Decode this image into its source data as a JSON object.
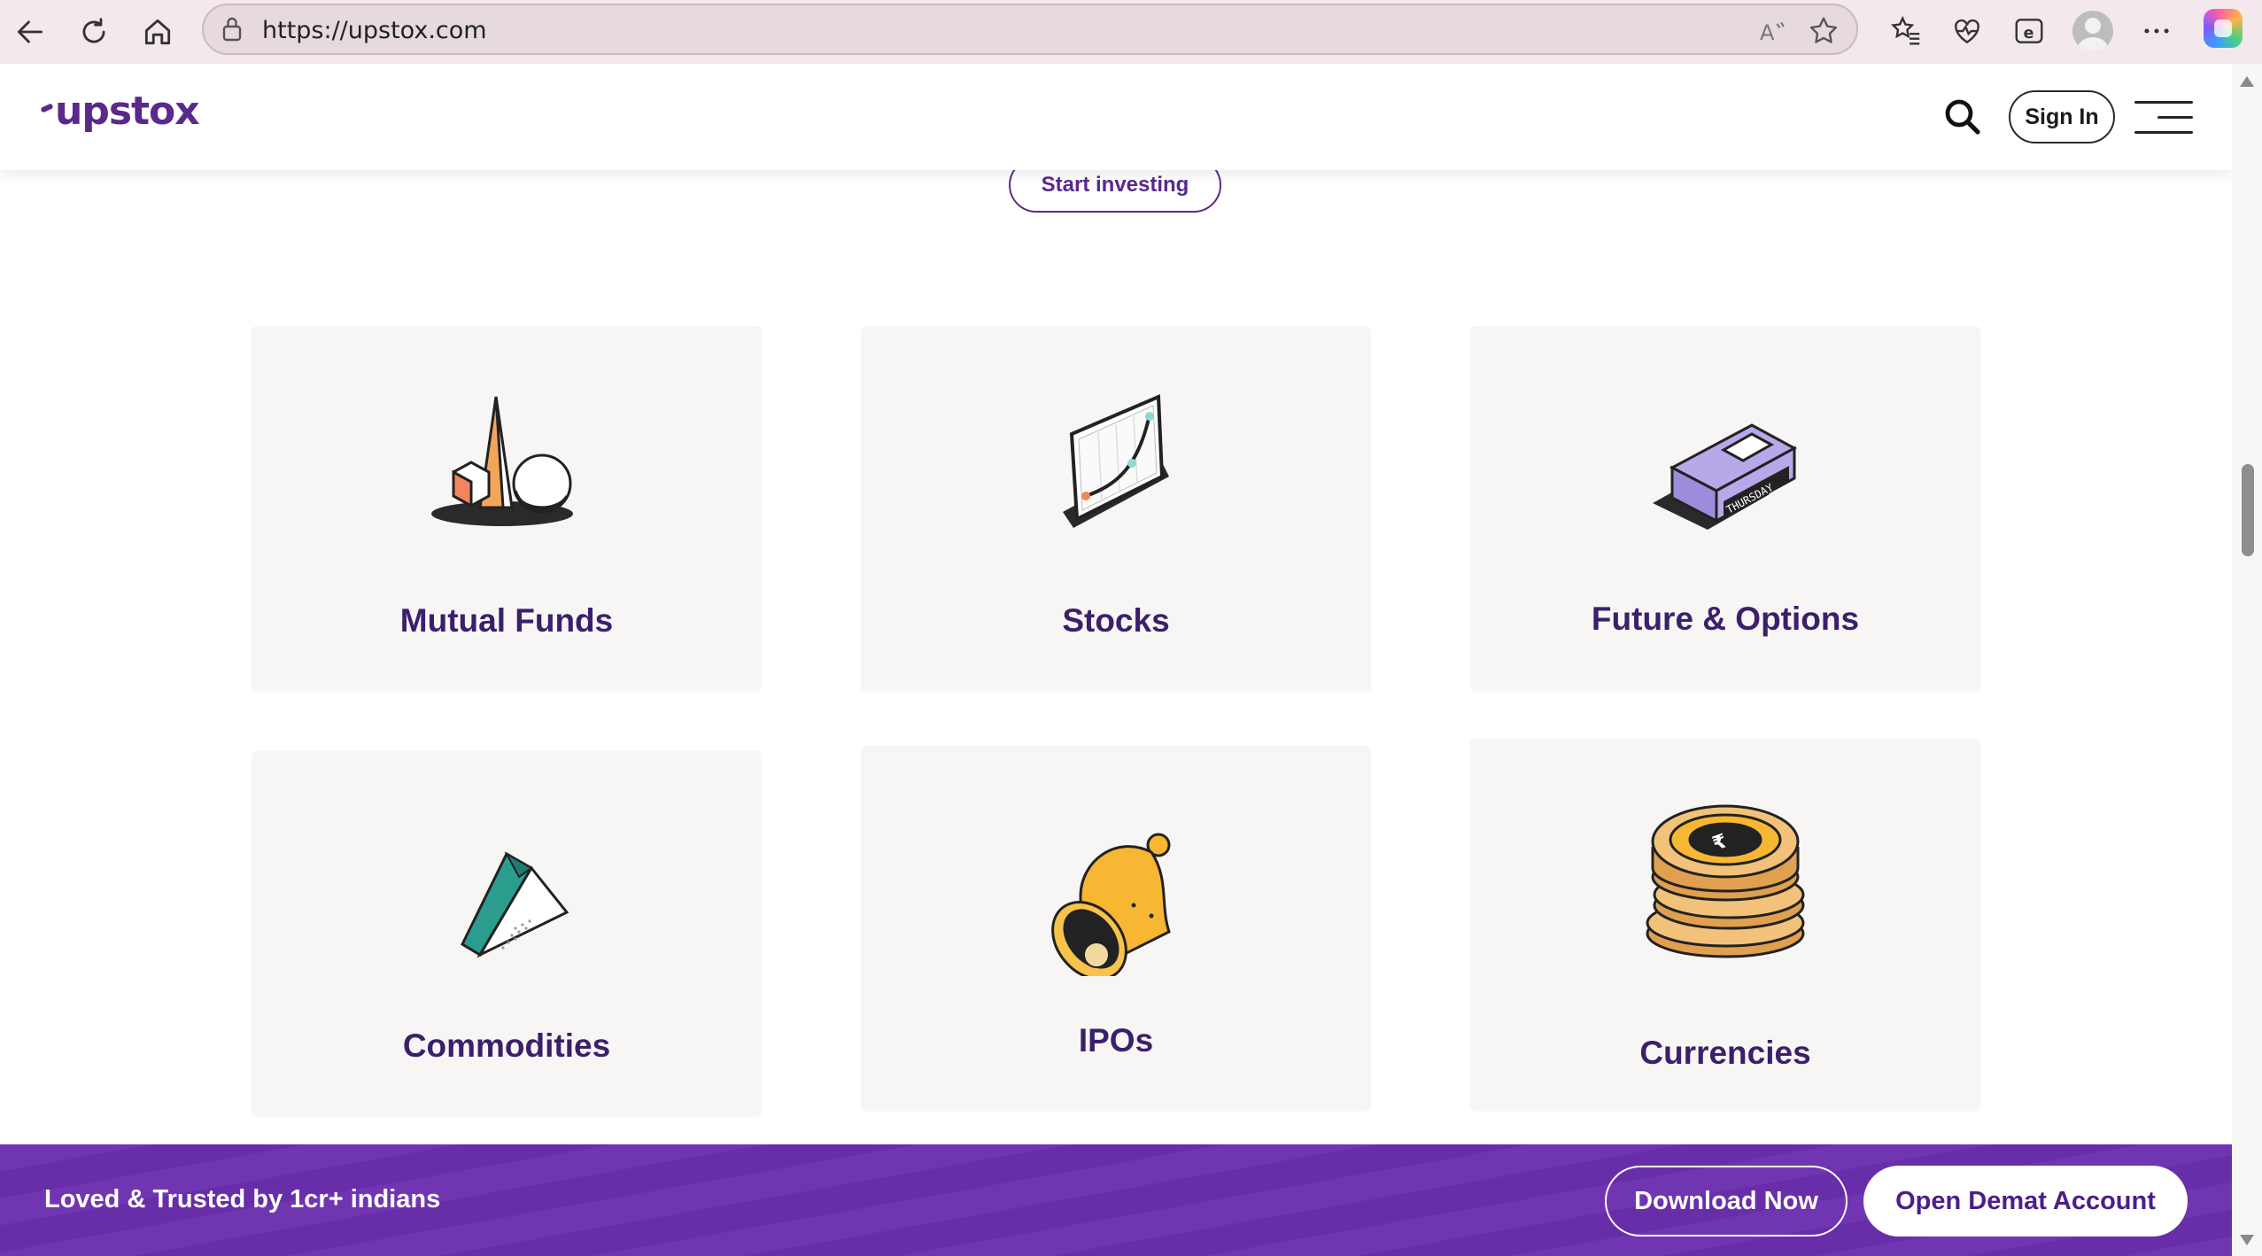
{
  "browser": {
    "url": "https://upstox.com",
    "icons": [
      "back-arrow-icon",
      "refresh-icon",
      "home-icon",
      "lock-icon",
      "read-aloud-icon",
      "favorite-star-icon",
      "favorites-icon",
      "health-icon",
      "edge-icon",
      "profile-icon",
      "more-icon",
      "copilot-icon"
    ]
  },
  "header": {
    "logo": "upstox",
    "sign_in": "Sign In"
  },
  "hero": {
    "cta": "Start investing"
  },
  "products": [
    {
      "label": "Mutual Funds",
      "icon": "shapes-icon"
    },
    {
      "label": "Stocks",
      "icon": "chart-tablet-icon"
    },
    {
      "label": "Future & Options",
      "icon": "calendar-block-icon",
      "badge": "THURSDAY"
    },
    {
      "label": "Commodities",
      "icon": "prism-icon"
    },
    {
      "label": "IPOs",
      "icon": "bell-icon"
    },
    {
      "label": "Currencies",
      "icon": "coin-stack-icon"
    }
  ],
  "banner": {
    "tagline": "Loved & Trusted by 1cr+ indians",
    "download": "Download Now",
    "open_account": "Open Demat Account"
  },
  "colors": {
    "brand_purple": "#5a298b",
    "banner_purple": "#6b30b0",
    "card_bg": "#f7f6f5",
    "label_color": "#3b1f6b"
  }
}
